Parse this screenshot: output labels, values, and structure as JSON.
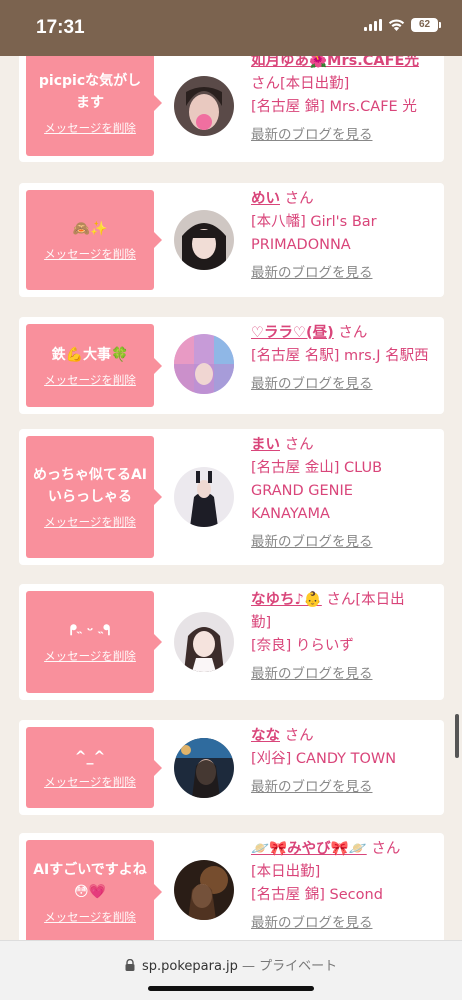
{
  "status_bar": {
    "time": "17:31",
    "battery": "62"
  },
  "cards": [
    {
      "message": "picpicな気がします",
      "delete_label": "メッセージを削除",
      "name": "如月ゆあ🌺Mrs.CAFE光",
      "after_name": "",
      "lines": [
        "さん[本日出勤]",
        "[名古屋 錦] Mrs.CAFE 光"
      ],
      "blog_label": "最新のブログを見る"
    },
    {
      "message": "🙈✨",
      "delete_label": "メッセージを削除",
      "name": "めい",
      "after_name": "さん",
      "lines": [
        "[本八幡] Girl's Bar",
        "PRIMADONNA"
      ],
      "blog_label": "最新のブログを見る"
    },
    {
      "message": "鉄💪大事🍀",
      "delete_label": "メッセージを削除",
      "name": "♡ララ♡(昼)",
      "after_name": "さん",
      "lines": [
        "[名古屋 名駅] mrs.J 名駅西"
      ],
      "blog_label": "最新のブログを見る"
    },
    {
      "message": "めっちゃ似てるAIいらっしゃる",
      "delete_label": "メッセージを削除",
      "name": "まい",
      "after_name": "さん",
      "lines": [
        "[名古屋 金山] CLUB",
        "GRAND GENIE",
        "KANAYAMA"
      ],
      "blog_label": "最新のブログを見る"
    },
    {
      "message": "ᖰ˵ ᵕ ˵ᖳ",
      "delete_label": "メッセージを削除",
      "name": "なゆち♪👶",
      "after_name": "さん[本日出",
      "lines": [
        "勤]",
        "[奈良] りらいず"
      ],
      "blog_label": "最新のブログを見る"
    },
    {
      "message": "^_^",
      "delete_label": "メッセージを削除",
      "name": "なな",
      "after_name": "さん",
      "lines": [
        "[刈谷] CANDY TOWN"
      ],
      "blog_label": "最新のブログを見る"
    },
    {
      "message": "AIすごいですよね😳💗",
      "delete_label": "メッセージを削除",
      "name": "🪐🎀みやび🎀🪐",
      "after_name": "さん",
      "lines": [
        "[本日出勤]",
        "[名古屋 錦] Second"
      ],
      "blog_label": "最新のブログを見る"
    }
  ],
  "browser": {
    "url": "sp.pokepara.jp",
    "mode": "— プライベート"
  },
  "colors": {
    "accent": "#f9909c",
    "link": "#d9457a",
    "status_bar": "#7b634f"
  }
}
